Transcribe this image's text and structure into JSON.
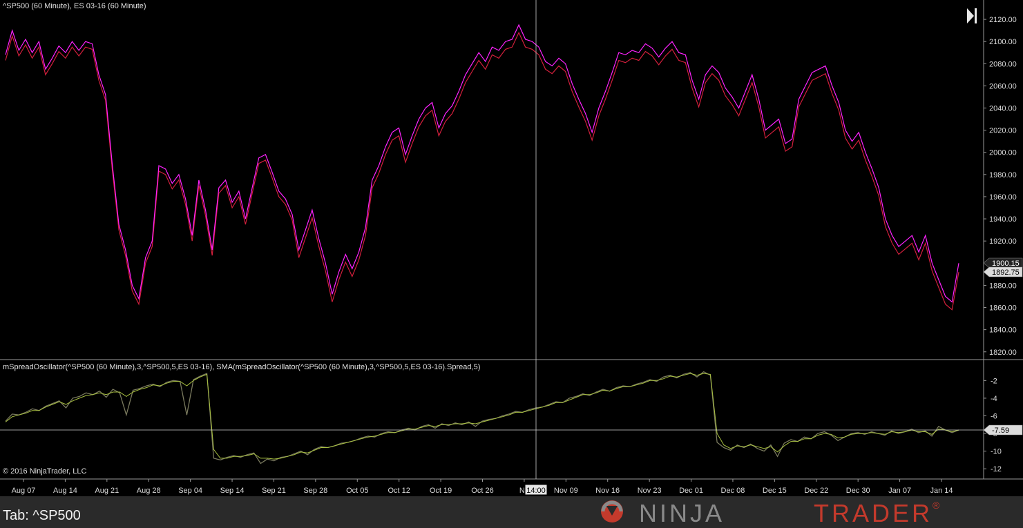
{
  "window": {
    "main_panel_title": "^SP500 (60 Minute), ES 03-16 (60 Minute)",
    "indicator_panel_title": "mSpreadOscillator(^SP500 (60 Minute),3,^SP500,5,ES 03-16), SMA(mSpreadOscillator(^SP500 (60 Minute),3,^SP500,5,ES 03-16).Spread,5)",
    "copyright": "© 2016 NinjaTrader, LLC",
    "crosshair_time_label": "14:00",
    "tab_label": "Tab: ^SP500",
    "brand_part1": "NINJA",
    "brand_part2": "TRADER",
    "brand_reg": "®",
    "colors": {
      "background": "#000000",
      "sp500_line": "#ff22ff",
      "es_line": "#d21f3c",
      "spread_line": "#7a7a5e",
      "sma_line": "#a8c040",
      "grid_line": "#ffffff",
      "brand_gray": "#8a8a8a",
      "brand_red": "#c43a2c"
    }
  },
  "chart_data": [
    {
      "type": "line",
      "title": "^SP500 (60 Minute), ES 03-16 (60 Minute)",
      "x_tick_labels": [
        "Aug 07",
        "Aug 14",
        "Aug 21",
        "Aug 28",
        "Sep 04",
        "Sep 14",
        "Sep 21",
        "Sep 28",
        "Oct 05",
        "Oct 12",
        "Oct 19",
        "Oct 26",
        "No",
        "Nov 09",
        "Nov 16",
        "Nov 23",
        "Dec 01",
        "Dec 08",
        "Dec 15",
        "Dec 22",
        "Dec 30",
        "Jan 07",
        "Jan 14"
      ],
      "y_tick_labels": [
        "2120.00",
        "2100.00",
        "2080.00",
        "2060.00",
        "2040.00",
        "2020.00",
        "2000.00",
        "1980.00",
        "1960.00",
        "1940.00",
        "1920.00",
        "1900.00",
        "1880.00",
        "1860.00",
        "1840.00",
        "1820.00"
      ],
      "ylim": [
        1813,
        2130
      ],
      "last_values": {
        "sp500": "1900.15",
        "es": "1892.75"
      },
      "series": [
        {
          "name": "^SP500 (60 Minute)",
          "color": "#ff22ff",
          "values": [
            2088,
            2110,
            2092,
            2102,
            2090,
            2100,
            2075,
            2085,
            2096,
            2090,
            2100,
            2092,
            2100,
            2098,
            2070,
            2052,
            1990,
            1935,
            1912,
            1880,
            1868,
            1905,
            1920,
            1988,
            1985,
            1972,
            1980,
            1958,
            1925,
            1975,
            1948,
            1912,
            1968,
            1975,
            1955,
            1965,
            1940,
            1968,
            1995,
            1998,
            1982,
            1965,
            1958,
            1944,
            1912,
            1930,
            1948,
            1922,
            1900,
            1872,
            1892,
            1908,
            1895,
            1910,
            1932,
            1975,
            1988,
            2005,
            2018,
            2022,
            1998,
            2015,
            2030,
            2040,
            2045,
            2022,
            2035,
            2042,
            2055,
            2070,
            2080,
            2090,
            2082,
            2095,
            2092,
            2100,
            2102,
            2115,
            2102,
            2100,
            2095,
            2082,
            2078,
            2085,
            2080,
            2062,
            2048,
            2035,
            2018,
            2040,
            2055,
            2072,
            2090,
            2088,
            2092,
            2090,
            2098,
            2094,
            2086,
            2094,
            2100,
            2090,
            2088,
            2065,
            2048,
            2070,
            2078,
            2072,
            2058,
            2050,
            2040,
            2055,
            2070,
            2048,
            2020,
            2025,
            2030,
            2008,
            2012,
            2048,
            2060,
            2072,
            2075,
            2078,
            2060,
            2045,
            2020,
            2010,
            2018,
            2000,
            1985,
            1968,
            1940,
            1925,
            1915,
            1920,
            1925,
            1910,
            1925,
            1900,
            1885,
            1870,
            1865,
            1900
          ]
        },
        {
          "name": "ES 03-16 (60 Minute)",
          "color": "#d21f3c",
          "values": [
            2083,
            2105,
            2087,
            2097,
            2085,
            2095,
            2070,
            2080,
            2091,
            2085,
            2095,
            2087,
            2095,
            2093,
            2065,
            2047,
            1985,
            1930,
            1907,
            1875,
            1863,
            1900,
            1915,
            1983,
            1980,
            1967,
            1975,
            1953,
            1920,
            1970,
            1943,
            1907,
            1963,
            1970,
            1950,
            1960,
            1935,
            1963,
            1990,
            1993,
            1977,
            1960,
            1953,
            1939,
            1905,
            1923,
            1941,
            1915,
            1893,
            1865,
            1885,
            1901,
            1888,
            1903,
            1925,
            1968,
            1981,
            1998,
            2011,
            2015,
            1991,
            2008,
            2023,
            2033,
            2038,
            2015,
            2028,
            2035,
            2048,
            2063,
            2073,
            2083,
            2075,
            2088,
            2085,
            2093,
            2095,
            2108,
            2095,
            2093,
            2088,
            2075,
            2071,
            2078,
            2073,
            2055,
            2041,
            2028,
            2011,
            2033,
            2048,
            2065,
            2083,
            2081,
            2085,
            2083,
            2091,
            2087,
            2079,
            2087,
            2093,
            2083,
            2081,
            2058,
            2041,
            2063,
            2071,
            2065,
            2051,
            2043,
            2033,
            2048,
            2063,
            2041,
            2013,
            2018,
            2023,
            2001,
            2005,
            2041,
            2053,
            2065,
            2068,
            2071,
            2053,
            2038,
            2013,
            2003,
            2011,
            1993,
            1978,
            1961,
            1933,
            1918,
            1908,
            1913,
            1918,
            1903,
            1918,
            1893,
            1878,
            1863,
            1858,
            1892
          ]
        }
      ]
    },
    {
      "type": "line",
      "title": "mSpreadOscillator(^SP500 (60 Minute),3,^SP500,5,ES 03-16), SMA(mSpreadOscillator(^SP500 (60 Minute),3,^SP500,5,ES 03-16).Spread,5)",
      "y_tick_labels": [
        "-2",
        "-4",
        "-6",
        "-8",
        "-10",
        "-12"
      ],
      "ylim": [
        -13.0,
        -0.8
      ],
      "last_value": "-7.59",
      "series": [
        {
          "name": "Spread",
          "color": "#7a7a5e",
          "values": [
            -6.6,
            -5.8,
            -5.9,
            -5.6,
            -5.2,
            -5.4,
            -4.9,
            -4.6,
            -4.3,
            -5.1,
            -4.0,
            -3.8,
            -3.4,
            -3.6,
            -3.2,
            -3.9,
            -3.0,
            -3.4,
            -5.9,
            -3.1,
            -2.9,
            -2.6,
            -2.4,
            -2.7,
            -2.2,
            -2.0,
            -2.1,
            -5.9,
            -1.9,
            -1.5,
            -1.2,
            -10.8,
            -11.0,
            -10.7,
            -10.5,
            -10.7,
            -10.4,
            -10.2,
            -11.4,
            -10.9,
            -11.1,
            -10.7,
            -10.6,
            -10.3,
            -10.0,
            -10.4,
            -9.8,
            -9.5,
            -9.6,
            -9.4,
            -9.1,
            -9.0,
            -8.8,
            -8.5,
            -8.3,
            -8.4,
            -8.0,
            -7.8,
            -7.9,
            -7.6,
            -7.4,
            -7.6,
            -7.2,
            -7.0,
            -7.4,
            -6.9,
            -7.1,
            -6.8,
            -7.0,
            -6.7,
            -7.2,
            -6.6,
            -6.4,
            -6.3,
            -6.0,
            -5.8,
            -5.5,
            -5.6,
            -5.3,
            -5.1,
            -5.0,
            -4.7,
            -4.4,
            -4.5,
            -4.0,
            -3.8,
            -3.5,
            -3.7,
            -3.3,
            -3.0,
            -3.2,
            -2.8,
            -2.6,
            -2.7,
            -2.4,
            -2.2,
            -1.9,
            -2.1,
            -1.6,
            -1.4,
            -1.7,
            -1.3,
            -1.1,
            -1.6,
            -1.0,
            -1.4,
            -9.0,
            -9.6,
            -9.9,
            -9.3,
            -9.6,
            -9.2,
            -9.7,
            -10.0,
            -9.3,
            -10.6,
            -9.1,
            -8.7,
            -8.9,
            -8.4,
            -8.6,
            -8.0,
            -7.8,
            -8.2,
            -8.8,
            -8.4,
            -8.0,
            -7.9,
            -8.1,
            -7.8,
            -8.0,
            -8.2,
            -7.7,
            -8.0,
            -7.8,
            -7.5,
            -7.9,
            -7.7,
            -8.3,
            -7.2,
            -7.6,
            -7.9,
            -7.6
          ]
        },
        {
          "name": "SMA",
          "color": "#a8c040",
          "values": [
            -6.7,
            -6.1,
            -5.9,
            -5.7,
            -5.4,
            -5.4,
            -5.0,
            -4.7,
            -4.4,
            -4.7,
            -4.3,
            -4.0,
            -3.7,
            -3.6,
            -3.4,
            -3.6,
            -3.3,
            -3.3,
            -3.8,
            -3.3,
            -3.0,
            -2.8,
            -2.5,
            -2.6,
            -2.3,
            -2.1,
            -2.1,
            -2.6,
            -2.0,
            -1.6,
            -1.3,
            -9.8,
            -10.8,
            -10.8,
            -10.6,
            -10.6,
            -10.5,
            -10.3,
            -10.8,
            -10.8,
            -10.9,
            -10.8,
            -10.6,
            -10.4,
            -10.1,
            -10.2,
            -9.9,
            -9.6,
            -9.6,
            -9.4,
            -9.2,
            -9.0,
            -8.8,
            -8.6,
            -8.4,
            -8.3,
            -8.1,
            -7.9,
            -7.9,
            -7.7,
            -7.5,
            -7.5,
            -7.3,
            -7.1,
            -7.2,
            -7.0,
            -7.0,
            -6.9,
            -6.9,
            -6.8,
            -6.9,
            -6.7,
            -6.5,
            -6.3,
            -6.1,
            -5.9,
            -5.6,
            -5.6,
            -5.4,
            -5.2,
            -5.0,
            -4.8,
            -4.5,
            -4.5,
            -4.2,
            -3.9,
            -3.6,
            -3.6,
            -3.4,
            -3.1,
            -3.2,
            -2.9,
            -2.7,
            -2.7,
            -2.5,
            -2.3,
            -2.0,
            -2.0,
            -1.8,
            -1.5,
            -1.6,
            -1.4,
            -1.2,
            -1.4,
            -1.2,
            -1.3,
            -8.0,
            -9.3,
            -9.7,
            -9.4,
            -9.5,
            -9.3,
            -9.5,
            -9.7,
            -9.5,
            -10.1,
            -9.4,
            -8.9,
            -8.9,
            -8.6,
            -8.6,
            -8.2,
            -8.0,
            -8.1,
            -8.5,
            -8.4,
            -8.1,
            -8.0,
            -8.0,
            -7.9,
            -8.0,
            -8.1,
            -7.8,
            -7.9,
            -7.8,
            -7.6,
            -7.8,
            -7.8,
            -8.1,
            -7.5,
            -7.6,
            -7.8,
            -7.6
          ]
        }
      ]
    }
  ]
}
